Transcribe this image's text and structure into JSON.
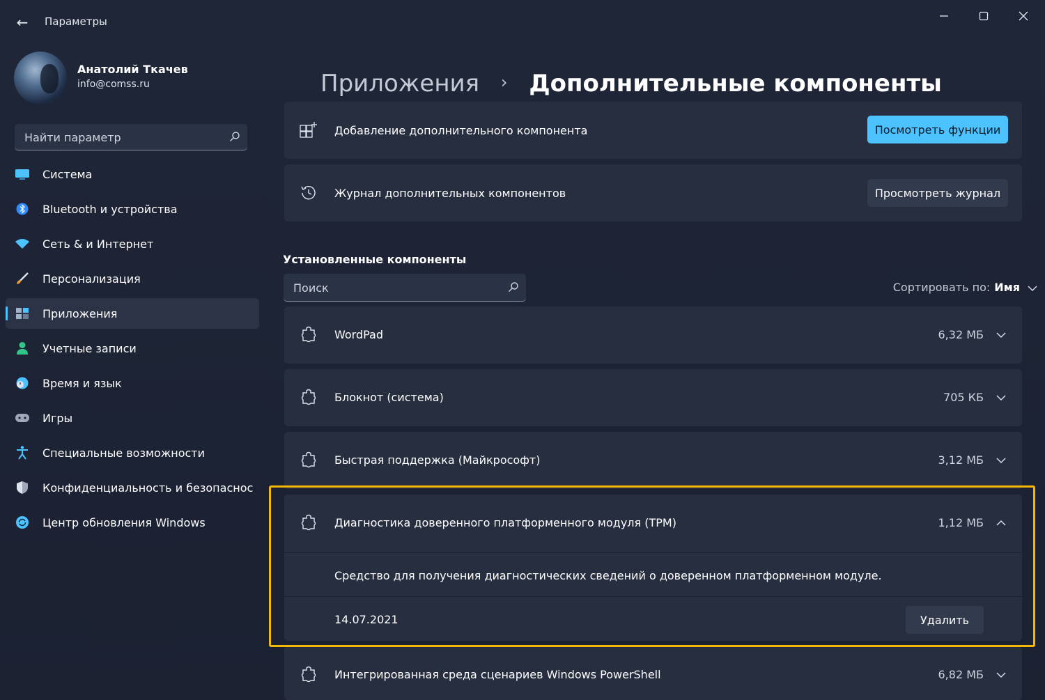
{
  "window": {
    "title": "Параметры",
    "back_icon": "arrow-left-icon",
    "controls": [
      "minimize-icon",
      "maximize-icon",
      "close-icon"
    ]
  },
  "profile": {
    "name": "Анатолий Ткачев",
    "email": "info@comss.ru"
  },
  "sidebar": {
    "search_placeholder": "Найти параметр",
    "items": [
      {
        "label": "Система",
        "icon": "monitor-icon",
        "color": "#4cc2ff"
      },
      {
        "label": "Bluetooth и устройства",
        "icon": "bluetooth-icon",
        "color": "#2f8bff"
      },
      {
        "label": "Сеть & и Интернет",
        "icon": "wifi-icon",
        "color": "#4cc2ff"
      },
      {
        "label": "Персонализация",
        "icon": "brush-icon",
        "color": "#f0a030"
      },
      {
        "label": "Приложения",
        "icon": "apps-icon",
        "color": "#9fb4cc",
        "active": true
      },
      {
        "label": "Учетные записи",
        "icon": "person-icon",
        "color": "#33c48a"
      },
      {
        "label": "Время и язык",
        "icon": "clock-globe-icon",
        "color": "#4cc2ff"
      },
      {
        "label": "Игры",
        "icon": "gamepad-icon",
        "color": "#a0a8b8"
      },
      {
        "label": "Специальные возможности",
        "icon": "accessibility-icon",
        "color": "#4cc2ff"
      },
      {
        "label": "Конфиденциальность и безопаснос",
        "icon": "shield-icon",
        "color": "#a0a8b8"
      },
      {
        "label": "Центр обновления Windows",
        "icon": "update-icon",
        "color": "#4cc2ff"
      }
    ]
  },
  "breadcrumb": {
    "parent": "Приложения",
    "current": "Дополнительные компоненты"
  },
  "add_card": {
    "label": "Добавление дополнительного компонента",
    "button": "Посмотреть функции",
    "icon": "add-grid-icon"
  },
  "history_card": {
    "label": "Журнал дополнительных компонентов",
    "button": "Просмотреть журнал",
    "icon": "history-icon"
  },
  "installed": {
    "title": "Установленные компоненты",
    "search_placeholder": "Поиск",
    "sort_label": "Сортировать по:",
    "sort_value": "Имя",
    "items": [
      {
        "name": "WordPad",
        "size": "6,32 МБ"
      },
      {
        "name": "Блокнот (система)",
        "size": "705 КБ"
      },
      {
        "name": "Быстрая поддержка (Майкрософт)",
        "size": "3,12 МБ"
      }
    ],
    "expanded": {
      "name": "Диагностика доверенного платформенного модуля (TPM)",
      "size": "1,12 МБ",
      "description": "Средство для получения диагностических сведений о доверенном платформенном модуле.",
      "date": "14.07.2021",
      "remove_button": "Удалить"
    },
    "last": {
      "name": "Интегрированная среда сценариев Windows PowerShell",
      "size": "6,82 МБ"
    }
  },
  "colors": {
    "accent": "#4cc2ff",
    "highlight": "#f2b705",
    "card": "#272e40",
    "background": "#1c2233"
  }
}
